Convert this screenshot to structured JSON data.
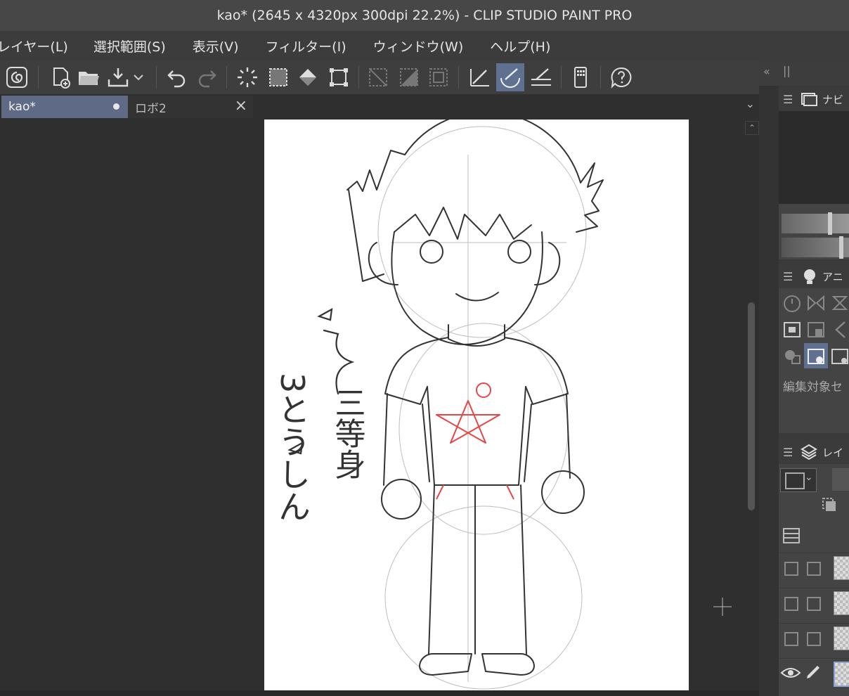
{
  "window": {
    "title": "kao* (2645 x 4320px 300dpi 22.2%)  - CLIP STUDIO PAINT PRO"
  },
  "menu": [
    {
      "label": "レイヤー(L)"
    },
    {
      "label": "選択範囲(S)"
    },
    {
      "label": "表示(V)"
    },
    {
      "label": "フィルター(I)"
    },
    {
      "label": "ウィンドウ(W)"
    },
    {
      "label": "ヘルプ(H)"
    }
  ],
  "toolbar": {
    "items": [
      "clip-studio-icon",
      "new-file-icon",
      "open-folder-icon",
      "save-icon",
      "undo-icon",
      "redo-icon",
      "clear-selection-icon",
      "select-all-icon",
      "fill-icon",
      "transform-icon",
      "ruler-snap-off-icon",
      "ruler-snap-icon",
      "ruler-snap-special-icon",
      "snap-to-ruler-icon",
      "snap-to-special-ruler-icon",
      "snap-to-grid-icon",
      "smartphone-icon",
      "help-icon"
    ],
    "active": "snap-to-special-ruler-icon"
  },
  "tabs": [
    {
      "label": "kao*",
      "active": true,
      "modified": true
    },
    {
      "label": "ロボ2",
      "active": false
    }
  ],
  "panels": {
    "navigator": {
      "label": "ナビ"
    },
    "animation": {
      "label": "アニ",
      "edit_target_text": "編集対象セ"
    },
    "layers": {
      "label": "レイ"
    }
  },
  "canvas": {
    "annotation_vertical": "三等身",
    "annotation_kana": "3とうしん",
    "colors": {
      "sketch": "#333333",
      "accent": "#e64646"
    }
  },
  "theme": {
    "accent": "#5f7091",
    "canvas_bg": "#2f2f2f"
  }
}
